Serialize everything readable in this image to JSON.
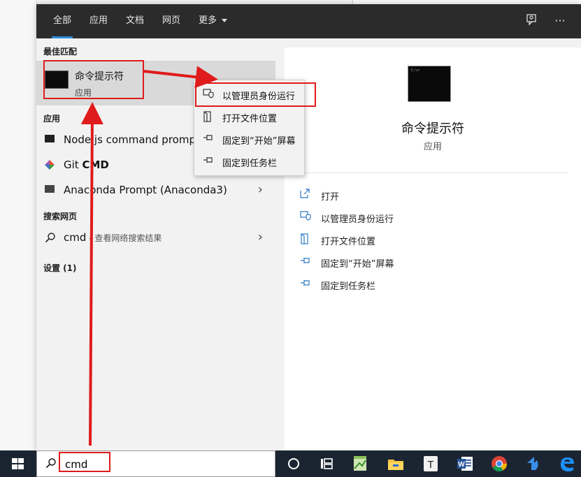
{
  "tabs": [
    {
      "label": "全部",
      "active": true
    },
    {
      "label": "应用"
    },
    {
      "label": "文档"
    },
    {
      "label": "网页"
    },
    {
      "label": "更多"
    }
  ],
  "topbar": {
    "feedback_icon": "feedback-icon",
    "more_icon": "···"
  },
  "best_match": {
    "header": "最佳匹配",
    "title": "命令提示符",
    "subtitle": "应用"
  },
  "apps": {
    "header": "应用",
    "items": [
      {
        "label": "Node.js command prompt",
        "icon": "console-icon"
      },
      {
        "label_prefix": "Git ",
        "label_bold": "CMD",
        "icon": "git-icon"
      },
      {
        "label": "Anaconda Prompt (Anaconda3)",
        "icon": "console-icon",
        "arrow": "›"
      }
    ]
  },
  "web": {
    "header": "搜索网页",
    "query": "cmd",
    "suffix": " - 查看网络搜索结果",
    "arrow": "›"
  },
  "settings": {
    "header": "设置 (1)"
  },
  "context_menu": {
    "items": [
      {
        "label": "以管理员身份运行",
        "icon": "shield-icon"
      },
      {
        "label": "打开文件位置",
        "icon": "folder-open-icon"
      },
      {
        "label": "固定到“开始”屏幕",
        "icon": "pin-icon"
      },
      {
        "label": "固定到任务栏",
        "icon": "pin-icon"
      }
    ]
  },
  "detail": {
    "title": "命令提示符",
    "subtitle": "应用",
    "actions": [
      {
        "label": "打开",
        "icon": "open-icon"
      },
      {
        "label": "以管理员身份运行",
        "icon": "shield-icon"
      },
      {
        "label": "打开文件位置",
        "icon": "folder-open-icon"
      },
      {
        "label": "固定到“开始”屏幕",
        "icon": "pin-icon"
      },
      {
        "label": "固定到任务栏",
        "icon": "pin-icon"
      }
    ]
  },
  "search": {
    "value": "cmd"
  },
  "taskbar": {
    "icons": [
      "task-view-icon",
      "timeline-icon",
      "notepad-icon",
      "file-explorer-icon",
      "typora-icon",
      "word-icon",
      "chrome-icon",
      "arrow-app-icon",
      "edge-icon"
    ]
  },
  "colors": {
    "accent": "#2e8bd8",
    "annotation": "#e01b1b",
    "taskbar": "#1b2532",
    "topbar": "#2b2b2b"
  }
}
